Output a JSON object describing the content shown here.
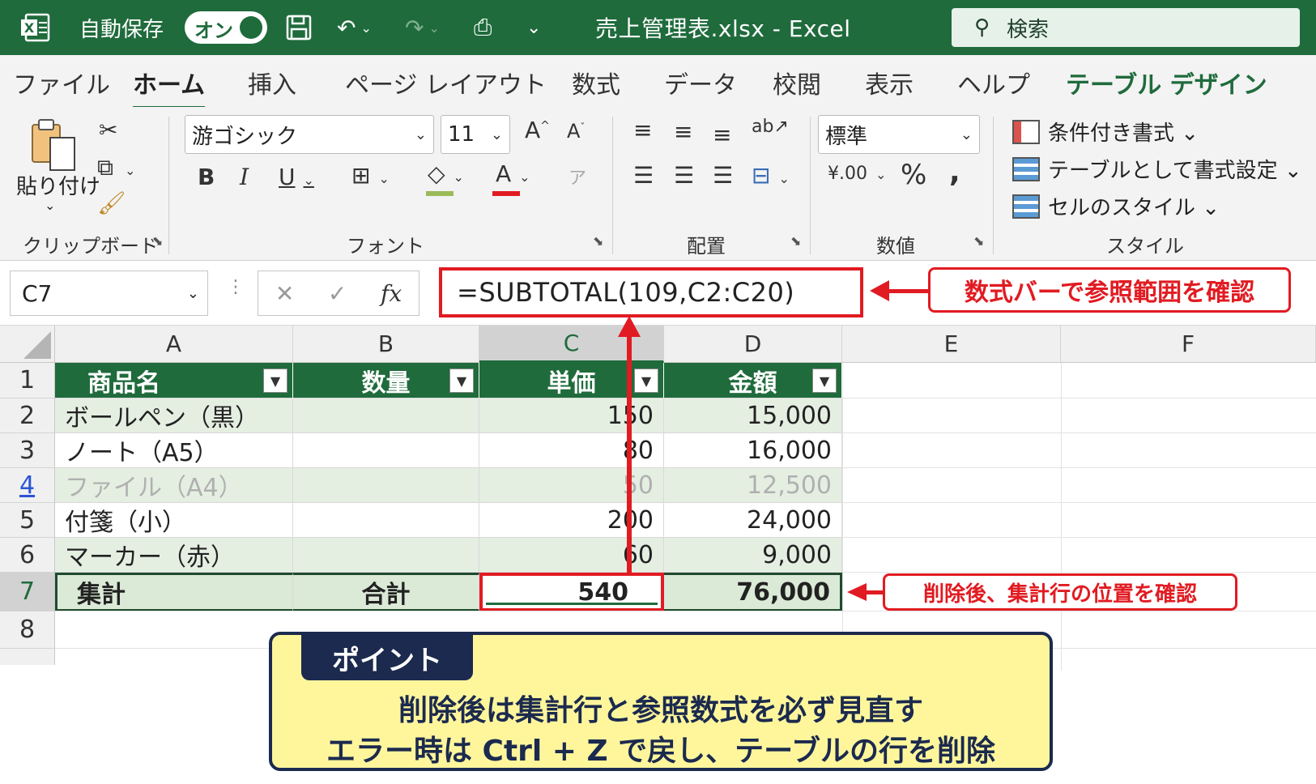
{
  "titlebar": {
    "autosave_label": "自動保存",
    "toggle_label": "オン",
    "doc_title": "売上管理表.xlsx  -  Excel",
    "search_placeholder": "検索"
  },
  "tabs": [
    "ファイル",
    "ホーム",
    "挿入",
    "ページ レイアウト",
    "数式",
    "データ",
    "校閲",
    "表示",
    "ヘルプ",
    "テーブル デザイン"
  ],
  "ribbon": {
    "clipboard": {
      "paste_label": "貼り付け",
      "group_label": "クリップボード"
    },
    "font": {
      "font_name": "游ゴシック",
      "font_size": "11",
      "group_label": "フォント"
    },
    "alignment": {
      "group_label": "配置"
    },
    "number": {
      "format": "標準",
      "group_label": "数値"
    },
    "styles": {
      "items": [
        "条件付き書式 ⌄",
        "テーブルとして書式設定 ⌄",
        "セルのスタイル ⌄"
      ],
      "group_label": "スタイル"
    }
  },
  "formula_bar": {
    "name_box": "C7",
    "formula": "=SUBTOTAL(109,C2:C20)"
  },
  "callouts": {
    "formula_note": "数式バーで参照範囲を確認",
    "total_note": "削除後、集計行の位置を確認"
  },
  "grid": {
    "columns": [
      "A",
      "B",
      "C",
      "D",
      "E",
      "F"
    ],
    "rows": [
      "1",
      "2",
      "3",
      "4",
      "5",
      "6",
      "7",
      "8"
    ],
    "headers": [
      "商品名",
      "数量",
      "単価",
      "金額"
    ],
    "data": [
      {
        "name": "ボールペン（黒）",
        "qty": "",
        "price": "150",
        "amount": "15,000"
      },
      {
        "name": "ノート（A5）",
        "qty": "",
        "price": "80",
        "amount": "16,000"
      },
      {
        "name": "ファイル（A4）",
        "qty": "",
        "price": "50",
        "amount": "12,500"
      },
      {
        "name": "付箋（小）",
        "qty": "",
        "price": "200",
        "amount": "24,000"
      },
      {
        "name": "マーカー（赤）",
        "qty": "",
        "price": "60",
        "amount": "9,000"
      }
    ],
    "total_row": {
      "label": "集計",
      "qty": "合計",
      "price": "540",
      "amount": "76,000"
    }
  },
  "point": {
    "tag": "ポイント",
    "line1": "削除後は集計行と参照数式を必ず見直す",
    "line2": "エラー時は Ctrl + Z で戻し、テーブルの行を削除"
  }
}
